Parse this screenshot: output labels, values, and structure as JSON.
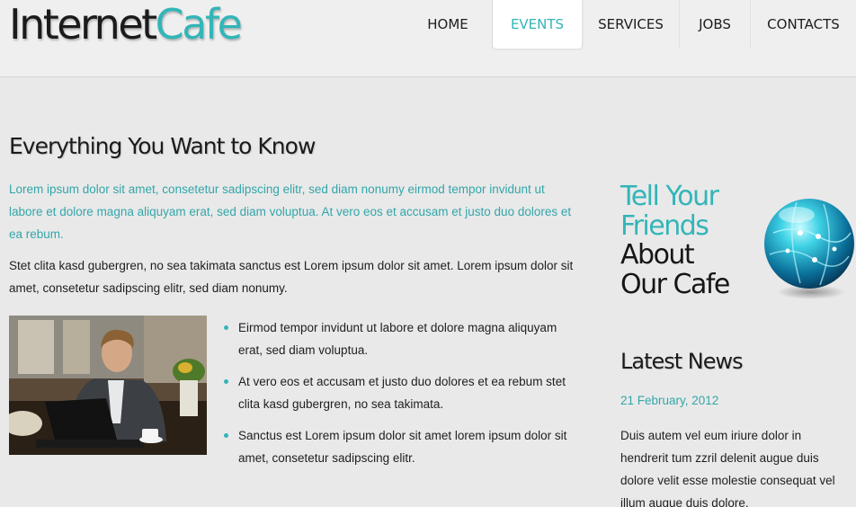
{
  "logo": {
    "part1": "Internet",
    "part2": "Cafe"
  },
  "nav": [
    {
      "label": "HOME",
      "active": false
    },
    {
      "label": "EVENTS",
      "active": true
    },
    {
      "label": "SERVICES",
      "active": false
    },
    {
      "label": "JOBS",
      "active": false
    },
    {
      "label": "CONTACTS",
      "active": false
    }
  ],
  "main": {
    "title": "Everything You Want to Know",
    "intro": "Lorem ipsum dolor sit amet, consetetur sadipscing elitr, sed diam nonumy eirmod tempor invidunt ut labore et dolore magna aliquyam erat, sed diam voluptua. At vero eos et accusam et justo duo dolores et ea rebum.",
    "body": "Stet clita kasd gubergren, no sea takimata sanctus est Lorem ipsum dolor sit amet. Lorem ipsum dolor sit amet, consetetur sadipscing elitr, sed diam nonumy.",
    "bullets": [
      "Eirmod tempor invidunt ut labore et dolore magna aliquyam erat, sed diam voluptua.",
      "At vero eos et accusam et justo duo dolores et ea rebum stet clita kasd gubergren, no sea takimata.",
      "Sanctus est Lorem ipsum dolor sit amet lorem ipsum dolor sit amet, consetetur sadipscing elitr."
    ]
  },
  "sidebar": {
    "promo_lines": [
      "Tell Your",
      "Friends",
      "About",
      "Our Cafe"
    ],
    "news_title": "Latest News",
    "news_date": "21 February, 2012",
    "news_body": "Duis autem vel eum iriure dolor in hendrerit tum zzril delenit augue duis dolore velit esse molestie consequat vel illum augue duis dolore."
  },
  "colors": {
    "accent": "#33b5b8",
    "text": "#1e1e1e",
    "background": "#e9e9e9",
    "header_background": "#efefef"
  },
  "icons": {
    "globe": "globe-icon",
    "bullet": "bullet-dot"
  }
}
